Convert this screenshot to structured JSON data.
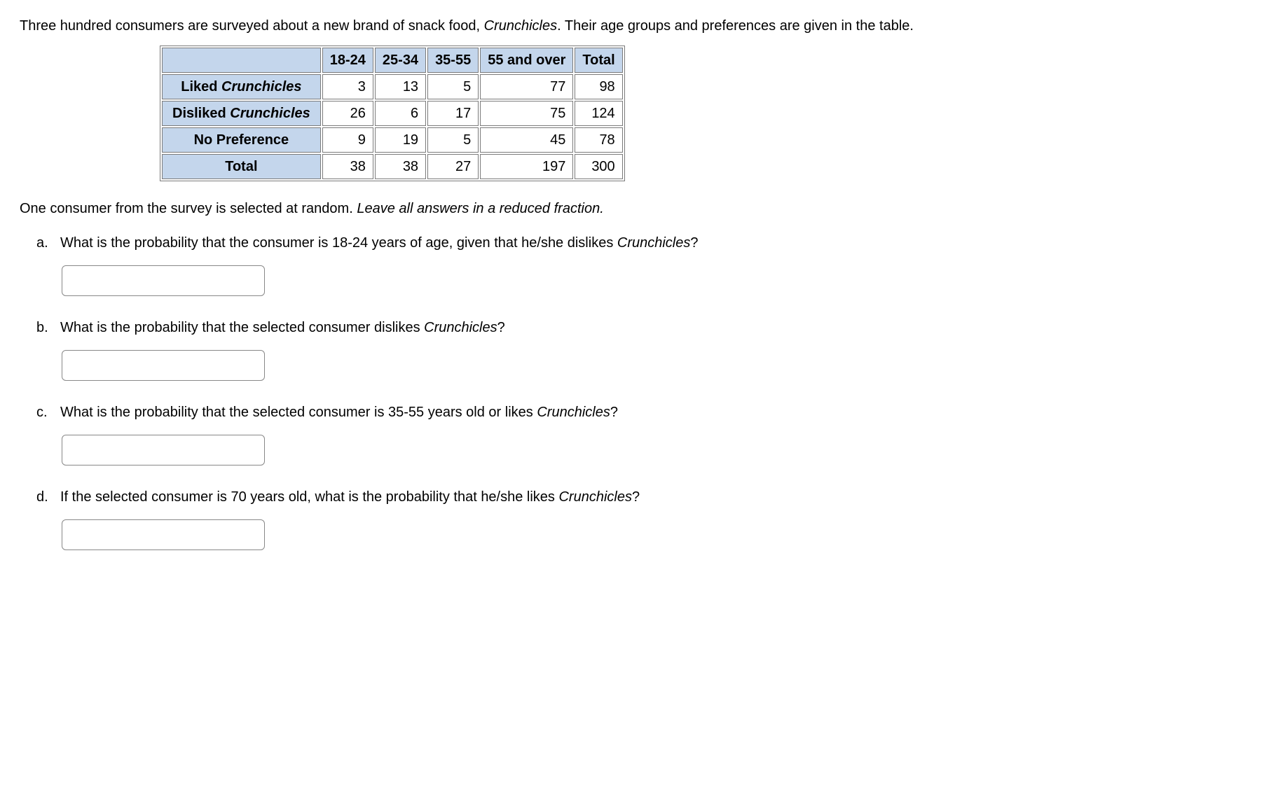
{
  "intro": {
    "before_brand": "Three hundred consumers are surveyed about a new brand of snack food, ",
    "brand": "Crunchicles",
    "after_brand": ". Their age groups and preferences are given in the table."
  },
  "table": {
    "col_headers": [
      "18-24",
      "25-34",
      "35-55",
      "55 and over",
      "Total"
    ],
    "rows": [
      {
        "label_pre": "Liked ",
        "label_brand": "Crunchicles",
        "label_post": "",
        "values": [
          "3",
          "13",
          "5",
          "77",
          "98"
        ]
      },
      {
        "label_pre": "Disliked ",
        "label_brand": "Crunchicles",
        "label_post": "",
        "values": [
          "26",
          "6",
          "17",
          "75",
          "124"
        ]
      },
      {
        "label_pre": "",
        "label_brand": "",
        "label_post": "No Preference",
        "values": [
          "9",
          "19",
          "5",
          "45",
          "78"
        ]
      },
      {
        "label_pre": "",
        "label_brand": "",
        "label_post": "Total",
        "values": [
          "38",
          "38",
          "27",
          "197",
          "300"
        ]
      }
    ]
  },
  "instruction": {
    "plain": "One consumer from the survey is selected at random. ",
    "ital": "Leave all answers in a reduced fraction."
  },
  "questions": {
    "a": {
      "label": "a.",
      "pre": "What is the probability that the consumer is 18-24 years of age, given that he/she dislikes ",
      "brand": "Crunchicles",
      "post": "?"
    },
    "b": {
      "label": "b.",
      "pre": "What is the probability that the selected consumer dislikes ",
      "brand": "Crunchicles",
      "post": "?"
    },
    "c": {
      "label": "c.",
      "pre": "What is the probability that the selected consumer is 35-55 years old or likes ",
      "brand": "Crunchicles",
      "post": "?"
    },
    "d": {
      "label": "d.",
      "pre": "If the selected consumer is 70 years old, what is the probability that he/she likes ",
      "brand": "Crunchicles",
      "post": "?"
    }
  },
  "chart_data": {
    "type": "table",
    "title": "Crunchicles survey: age group by preference",
    "columns": [
      "18-24",
      "25-34",
      "35-55",
      "55 and over",
      "Total"
    ],
    "rows": [
      "Liked Crunchicles",
      "Disliked Crunchicles",
      "No Preference",
      "Total"
    ],
    "values": [
      [
        3,
        13,
        5,
        77,
        98
      ],
      [
        26,
        6,
        17,
        75,
        124
      ],
      [
        9,
        19,
        5,
        45,
        78
      ],
      [
        38,
        38,
        27,
        197,
        300
      ]
    ]
  }
}
